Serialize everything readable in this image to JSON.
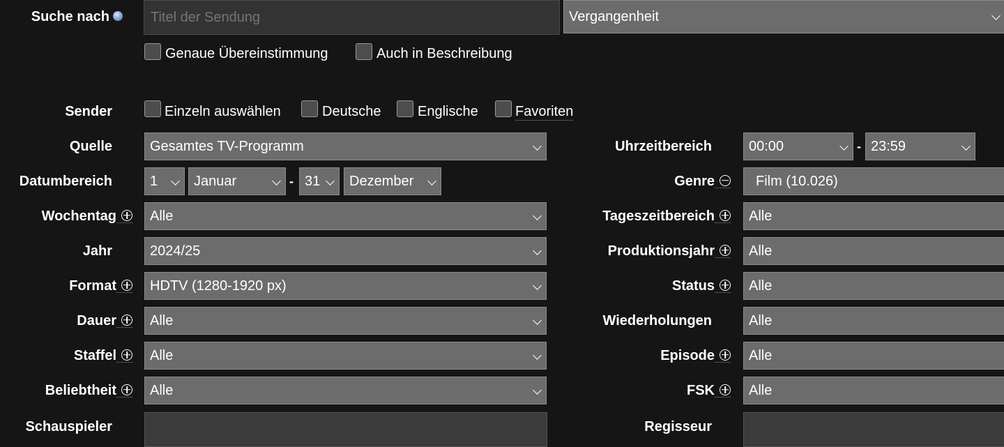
{
  "search": {
    "label": "Suche nach",
    "placeholder": "Titel der Sendung",
    "time_select": "Vergangenheit",
    "exact_match_label": "Genaue Übereinstimmung",
    "in_description_label": "Auch in Beschreibung"
  },
  "sender": {
    "label": "Sender",
    "options": [
      "Einzeln auswählen",
      "Deutsche",
      "Englische",
      "Favoriten"
    ]
  },
  "quelle": {
    "label": "Quelle",
    "value": "Gesamtes TV-Programm"
  },
  "datum": {
    "label": "Datumbereich",
    "from_day": "1",
    "from_month": "Januar",
    "dash": "-",
    "to_day": "31",
    "to_month": "Dezember"
  },
  "wochentag": {
    "label": "Wochentag",
    "value": "Alle"
  },
  "jahr": {
    "label": "Jahr",
    "value": "2024/25"
  },
  "format": {
    "label": "Format",
    "value": "HDTV (1280-1920 px)"
  },
  "dauer": {
    "label": "Dauer",
    "value": "Alle"
  },
  "staffel": {
    "label": "Staffel",
    "value": "Alle"
  },
  "beliebtheit": {
    "label": "Beliebtheit",
    "value": "Alle"
  },
  "schauspieler": {
    "label": "Schauspieler",
    "value": ""
  },
  "uhrzeit": {
    "label": "Uhrzeitbereich",
    "from": "00:00",
    "dash": "-",
    "to": "23:59"
  },
  "genre": {
    "label": "Genre",
    "value": "Film (10.026)"
  },
  "tageszeit": {
    "label": "Tageszeitbereich",
    "value": "Alle"
  },
  "produktionsjahr": {
    "label": "Produktionsjahr",
    "value": "Alle"
  },
  "status": {
    "label": "Status",
    "value": "Alle"
  },
  "wiederholungen": {
    "label": "Wiederholungen",
    "value": "Alle"
  },
  "episode": {
    "label": "Episode",
    "value": "Alle"
  },
  "fsk": {
    "label": "FSK",
    "value": "Alle"
  },
  "regisseur": {
    "label": "Regisseur",
    "value": ""
  }
}
